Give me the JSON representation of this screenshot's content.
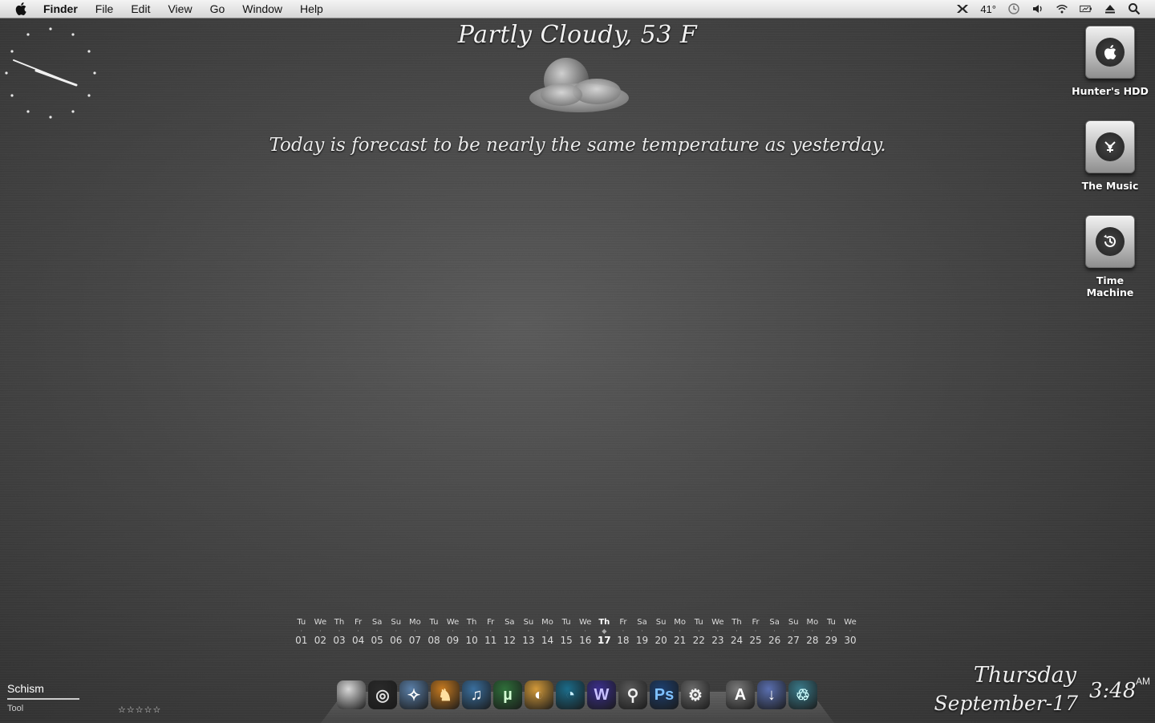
{
  "menubar": {
    "app_name": "Finder",
    "menus": [
      "File",
      "Edit",
      "View",
      "Go",
      "Window",
      "Help"
    ],
    "temperature": "41°",
    "status_icons": [
      "tools-icon",
      "time-machine-icon",
      "volume-icon",
      "wifi-icon",
      "battery-icon",
      "eject-icon",
      "spotlight-icon"
    ]
  },
  "weather": {
    "title": "Partly Cloudy, 53 F",
    "forecast": "Today is forecast to be nearly the same temperature as yesterday."
  },
  "drives": [
    {
      "label": "Hunter's HDD",
      "icon": "apple-icon"
    },
    {
      "label": "The Music",
      "icon": "firewire-icon"
    },
    {
      "label": "Time Machine",
      "icon": "time-machine-icon"
    }
  ],
  "calendar": {
    "days": [
      {
        "dow": "Tu",
        "num": "01"
      },
      {
        "dow": "We",
        "num": "02"
      },
      {
        "dow": "Th",
        "num": "03"
      },
      {
        "dow": "Fr",
        "num": "04"
      },
      {
        "dow": "Sa",
        "num": "05"
      },
      {
        "dow": "Su",
        "num": "06"
      },
      {
        "dow": "Mo",
        "num": "07"
      },
      {
        "dow": "Tu",
        "num": "08"
      },
      {
        "dow": "We",
        "num": "09"
      },
      {
        "dow": "Th",
        "num": "10"
      },
      {
        "dow": "Fr",
        "num": "11"
      },
      {
        "dow": "Sa",
        "num": "12"
      },
      {
        "dow": "Su",
        "num": "13"
      },
      {
        "dow": "Mo",
        "num": "14"
      },
      {
        "dow": "Tu",
        "num": "15"
      },
      {
        "dow": "We",
        "num": "16"
      },
      {
        "dow": "Th",
        "num": "17",
        "today": true
      },
      {
        "dow": "Fr",
        "num": "18"
      },
      {
        "dow": "Sa",
        "num": "19"
      },
      {
        "dow": "Su",
        "num": "20"
      },
      {
        "dow": "Mo",
        "num": "21"
      },
      {
        "dow": "Tu",
        "num": "22"
      },
      {
        "dow": "We",
        "num": "23"
      },
      {
        "dow": "Th",
        "num": "24"
      },
      {
        "dow": "Fr",
        "num": "25"
      },
      {
        "dow": "Sa",
        "num": "26"
      },
      {
        "dow": "Su",
        "num": "27"
      },
      {
        "dow": "Mo",
        "num": "28"
      },
      {
        "dow": "Tu",
        "num": "29"
      },
      {
        "dow": "We",
        "num": "30"
      }
    ]
  },
  "now_playing": {
    "title": "Schism",
    "artist": "Tool",
    "rating": "☆☆☆☆☆"
  },
  "dock": {
    "apps": [
      {
        "name": "finder-app",
        "glyph": "",
        "bg": "#d8d8d8",
        "fg": "#ffffff"
      },
      {
        "name": "dashboard-app",
        "glyph": "◎",
        "bg": "#2a2a2a",
        "fg": "#e0e0e0"
      },
      {
        "name": "safari-app",
        "glyph": "✧",
        "bg": "#5a7fa8",
        "fg": "#ffffff"
      },
      {
        "name": "firefox-app",
        "glyph": "♞",
        "bg": "#c67a20",
        "fg": "#ffe0a0"
      },
      {
        "name": "itunes-app",
        "glyph": "♫",
        "bg": "#3a6f9e",
        "fg": "#ffffff"
      },
      {
        "name": "utorrent-app",
        "glyph": "µ",
        "bg": "#2f6f3a",
        "fg": "#d4ffd4"
      },
      {
        "name": "adium-app",
        "glyph": "◐",
        "bg": "#d39a3a",
        "fg": "#ffffff"
      },
      {
        "name": "camino-app",
        "glyph": "◔",
        "bg": "#1b6c8a",
        "fg": "#c8f0ff"
      },
      {
        "name": "wolf-app",
        "glyph": "W",
        "bg": "#3b2f8c",
        "fg": "#c8c0ff"
      },
      {
        "name": "preview-app",
        "glyph": "⚲",
        "bg": "#5a5a5a",
        "fg": "#f0f0f0"
      },
      {
        "name": "photoshop-app",
        "glyph": "Ps",
        "bg": "#1d3f6e",
        "fg": "#7fc1ff"
      },
      {
        "name": "system-preferences-app",
        "glyph": "⚙",
        "bg": "#6a6a6a",
        "fg": "#f0f0f0"
      }
    ],
    "stacks": [
      {
        "name": "applications-stack",
        "glyph": "A",
        "bg": "#7a7a7a",
        "fg": "#ffffff"
      },
      {
        "name": "downloads-stack",
        "glyph": "↓",
        "bg": "#5a6fb0",
        "fg": "#ffffff"
      },
      {
        "name": "trash-app",
        "glyph": "♲",
        "bg": "#3a7a8a",
        "fg": "#cfffff"
      }
    ]
  },
  "datetime": {
    "weekday": "Thursday",
    "date": "September-17",
    "time": "3:48",
    "ampm": "AM"
  }
}
